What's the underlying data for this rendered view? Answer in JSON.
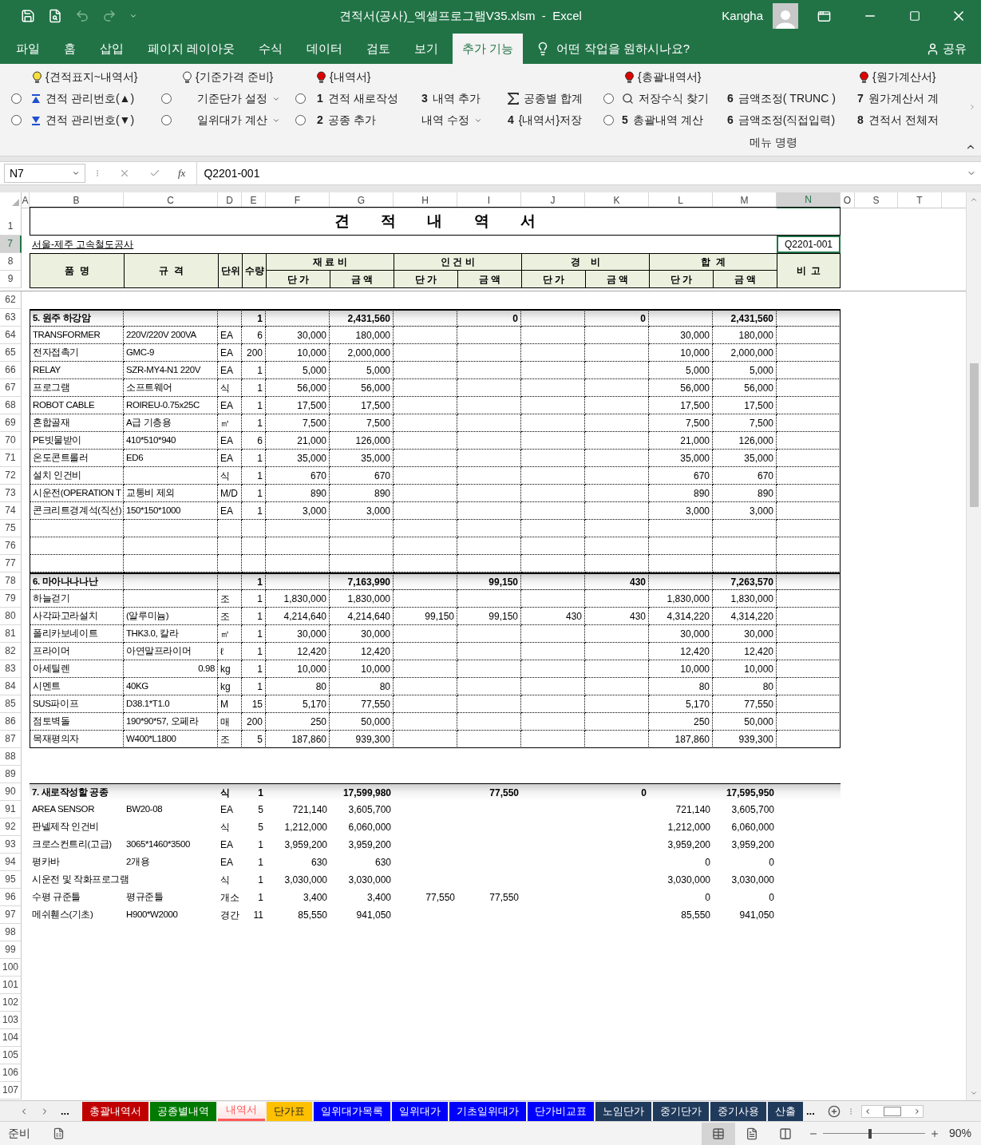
{
  "title_bar": {
    "quick_access": [
      {
        "kind": "save",
        "disabled": false
      },
      {
        "kind": "preview",
        "disabled": false
      },
      {
        "kind": "undo",
        "disabled": true
      },
      {
        "kind": "redo",
        "disabled": true
      }
    ],
    "title": "견적서(공사)_엑셀프로그램V35.xlsm  -  Excel",
    "user": "Kangha"
  },
  "menu_tabs": [
    {
      "label": "파일",
      "selected": false
    },
    {
      "label": "홈",
      "selected": false
    },
    {
      "label": "삽입",
      "selected": false
    },
    {
      "label": "페이지 레이아웃",
      "selected": false
    },
    {
      "label": "수식",
      "selected": false
    },
    {
      "label": "데이터",
      "selected": false
    },
    {
      "label": "검토",
      "selected": false
    },
    {
      "label": "보기",
      "selected": false
    },
    {
      "label": "추가 기능",
      "selected": true
    }
  ],
  "tell_me": "어떤 작업을 원하시나요?",
  "share": "공유",
  "ribbon": {
    "columns": [
      {
        "header": {
          "label": "{견적표지~내역서}",
          "color": "#f7e03c"
        },
        "items": [
          {
            "radio": {
              "selected": false
            },
            "kind": "ascending",
            "label": "견적 관리번호(▲)"
          },
          {
            "radio": {
              "selected": false
            },
            "kind": "descending",
            "label": "견적 관리번호(▼)"
          }
        ]
      },
      {
        "header": {
          "label": "{기준가격 준비}",
          "color": "#ffffff"
        },
        "items": [
          {
            "radio": {
              "selected": false
            },
            "kind": "dropdown",
            "label": "기준단가 설정"
          },
          {
            "radio": {
              "selected": false
            },
            "kind": "dropdown",
            "label": "일위대가 계산"
          }
        ]
      },
      {
        "header": {
          "label": "{내역서}",
          "color": "#e00000"
        },
        "items": [
          {
            "radio": {
              "selected": false
            },
            "kind": "text",
            "key": "1",
            "label": "견적 새로작성"
          },
          {
            "radio": {
              "selected": false
            },
            "kind": "text",
            "key": "2",
            "label": "공종 추가"
          }
        ]
      },
      {
        "items": [
          {
            "kind": "text",
            "key": "3",
            "label": "내역 추가"
          },
          {
            "kind": "dropdown",
            "label": "내역 수정"
          }
        ]
      },
      {
        "items": [
          {
            "kind": "sum",
            "label": "공종별 합계"
          },
          {
            "kind": "text",
            "key": "4",
            "label": "{내역서}저장"
          }
        ]
      },
      {
        "header": {
          "label": "{총괄내역서}",
          "color": "#e00000"
        },
        "items": [
          {
            "radio": {
              "selected": false
            },
            "kind": "search",
            "label": "저장수식 찾기"
          },
          {
            "radio": {
              "selected": false
            },
            "kind": "text",
            "key": "5",
            "label": "총괄내역 계산"
          }
        ]
      },
      {
        "items": [
          {
            "kind": "text",
            "key": "6",
            "label": "금액조정( TRUNC )"
          },
          {
            "kind": "text",
            "key": "6",
            "label": "금액조정(직접입력)"
          }
        ]
      },
      {
        "header": {
          "label": "{원가계산서}",
          "color": "#e00000"
        },
        "items": [
          {
            "kind": "text",
            "key": "7",
            "label": "원가계산서 계"
          },
          {
            "kind": "text",
            "key": "8",
            "label": "견적서 전체저"
          }
        ]
      }
    ],
    "group_label": "메뉴 명령"
  },
  "formula_bar": {
    "name_box": "N7",
    "function_label": "fx",
    "value": "Q2201-001"
  },
  "sheet": {
    "columns": [
      {
        "label": "A",
        "selected": false
      },
      {
        "label": "B",
        "selected": false
      },
      {
        "label": "C",
        "selected": false
      },
      {
        "label": "D",
        "selected": false
      },
      {
        "label": "E",
        "selected": false
      },
      {
        "label": "F",
        "selected": false
      },
      {
        "label": "G",
        "selected": false
      },
      {
        "label": "H",
        "selected": false
      },
      {
        "label": "I",
        "selected": false
      },
      {
        "label": "J",
        "selected": false
      },
      {
        "label": "K",
        "selected": false
      },
      {
        "label": "L",
        "selected": false
      },
      {
        "label": "M",
        "selected": false
      },
      {
        "label": "N",
        "selected": true
      },
      {
        "label": "O",
        "selected": false
      },
      {
        "label": "S",
        "selected": false
      },
      {
        "label": "T",
        "selected": false
      }
    ],
    "title_row": {
      "num": "1",
      "selected": false,
      "title": "견 적 내 역 서"
    },
    "info_row": {
      "num": "7",
      "selected": true,
      "project": "서울-제주 고속철도공사",
      "quote_no": "Q2201-001"
    },
    "header_rows": {
      "nums": [
        "8",
        "9"
      ],
      "fixed": [
        "품  명",
        "규  격",
        "단위",
        "수량"
      ],
      "groups": [
        {
          "label": "재 료 비",
          "columns": [
            "단 가",
            "금 액"
          ]
        },
        {
          "label": "인 건 비",
          "columns": [
            "단 가",
            "금 액"
          ]
        },
        {
          "label": "경    비",
          "columns": [
            "단 가",
            "금 액"
          ]
        },
        {
          "label": "합  계",
          "columns": [
            "단 가",
            "금 액"
          ]
        }
      ],
      "note": "비  고"
    },
    "rows": [
      {
        "num": "62",
        "selected": false,
        "kind": "item",
        "boxed": false
      },
      {
        "num": "63",
        "selected": false,
        "kind": "group",
        "boxed": true,
        "cells": {
          "B": "5. 원주 하강암",
          "E": "1",
          "G": "2,431,560",
          "I": "0",
          "K": "0",
          "M": "2,431,560"
        }
      },
      {
        "num": "64",
        "selected": false,
        "kind": "item",
        "boxed": true,
        "cells": {
          "B": "TRANSFORMER",
          "C": "220V/220V 200VA",
          "D": "EA",
          "E": "6",
          "F": "30,000",
          "G": "180,000",
          "L": "30,000",
          "M": "180,000"
        }
      },
      {
        "num": "65",
        "selected": false,
        "kind": "item",
        "boxed": true,
        "cells": {
          "B": "전자접촉기",
          "C": "GMC-9",
          "D": "EA",
          "E": "200",
          "F": "10,000",
          "G": "2,000,000",
          "L": "10,000",
          "M": "2,000,000"
        }
      },
      {
        "num": "66",
        "selected": false,
        "kind": "item",
        "boxed": true,
        "cells": {
          "B": "RELAY",
          "C": "SZR-MY4-N1 220V",
          "D": "EA",
          "E": "1",
          "F": "5,000",
          "G": "5,000",
          "L": "5,000",
          "M": "5,000"
        }
      },
      {
        "num": "67",
        "selected": false,
        "kind": "item",
        "boxed": true,
        "cells": {
          "B": "프로그램",
          "C": "소프트웨어",
          "D": "식",
          "E": "1",
          "F": "56,000",
          "G": "56,000",
          "L": "56,000",
          "M": "56,000"
        }
      },
      {
        "num": "68",
        "selected": false,
        "kind": "item",
        "boxed": true,
        "cells": {
          "B": "ROBOT CABLE",
          "C": "ROIREU-0.75x25C",
          "D": "EA",
          "E": "1",
          "F": "17,500",
          "G": "17,500",
          "L": "17,500",
          "M": "17,500"
        }
      },
      {
        "num": "69",
        "selected": false,
        "kind": "item",
        "boxed": true,
        "cells": {
          "B": "혼합골재",
          "C": "A급 기층용",
          "D": "㎥",
          "E": "1",
          "F": "7,500",
          "G": "7,500",
          "L": "7,500",
          "M": "7,500"
        }
      },
      {
        "num": "70",
        "selected": false,
        "kind": "item",
        "boxed": true,
        "cells": {
          "B": "PE빗물받이",
          "C": "410*510*940",
          "D": "EA",
          "E": "6",
          "F": "21,000",
          "G": "126,000",
          "L": "21,000",
          "M": "126,000"
        }
      },
      {
        "num": "71",
        "selected": false,
        "kind": "item",
        "boxed": true,
        "cells": {
          "B": "온도콘트롤러",
          "C": "ED6",
          "D": "EA",
          "E": "1",
          "F": "35,000",
          "G": "35,000",
          "L": "35,000",
          "M": "35,000"
        }
      },
      {
        "num": "72",
        "selected": false,
        "kind": "item",
        "boxed": true,
        "cells": {
          "B": "설치 인건비",
          "D": "식",
          "E": "1",
          "F": "670",
          "G": "670",
          "L": "670",
          "M": "670"
        }
      },
      {
        "num": "73",
        "selected": false,
        "kind": "item",
        "boxed": true,
        "cells": {
          "B": "시운전(OPERATION T",
          "C": "교통비 제외",
          "D": "M/D",
          "E": "1",
          "F": "890",
          "G": "890",
          "L": "890",
          "M": "890"
        }
      },
      {
        "num": "74",
        "selected": false,
        "kind": "item",
        "boxed": true,
        "cells": {
          "B": "콘크리트경계석(직선)",
          "C": "150*150*1000",
          "D": "EA",
          "E": "1",
          "F": "3,000",
          "G": "3,000",
          "L": "3,000",
          "M": "3,000"
        }
      },
      {
        "num": "75",
        "selected": false,
        "kind": "item",
        "boxed": true
      },
      {
        "num": "76",
        "selected": false,
        "kind": "item",
        "boxed": true
      },
      {
        "num": "77",
        "selected": false,
        "kind": "item",
        "boxed": true
      },
      {
        "num": "78",
        "selected": false,
        "kind": "group",
        "boxed": true,
        "cells": {
          "B": "6. 마아나나나난",
          "E": "1",
          "G": "7,163,990",
          "I": "99,150",
          "K": "430",
          "M": "7,263,570"
        }
      },
      {
        "num": "79",
        "selected": false,
        "kind": "item",
        "boxed": true,
        "cells": {
          "B": "하늘걷기",
          "D": "조",
          "E": "1",
          "F": "1,830,000",
          "G": "1,830,000",
          "L": "1,830,000",
          "M": "1,830,000"
        }
      },
      {
        "num": "80",
        "selected": false,
        "kind": "item",
        "boxed": true,
        "cells": {
          "B": "사각파고라설치",
          "C": "(알루미늄)",
          "D": "조",
          "E": "1",
          "F": "4,214,640",
          "G": "4,214,640",
          "H": "99,150",
          "I": "99,150",
          "J": "430",
          "K": "430",
          "L": "4,314,220",
          "M": "4,314,220"
        }
      },
      {
        "num": "81",
        "selected": false,
        "kind": "item",
        "boxed": true,
        "cells": {
          "B": "폴리카보네이트",
          "C": "THK3.0, 칼라",
          "D": "㎡",
          "E": "1",
          "F": "30,000",
          "G": "30,000",
          "L": "30,000",
          "M": "30,000"
        }
      },
      {
        "num": "82",
        "selected": false,
        "kind": "item",
        "boxed": true,
        "cells": {
          "B": "프라이머",
          "C": "아연말프라이머",
          "D": "ℓ",
          "E": "1",
          "F": "12,420",
          "G": "12,420",
          "L": "12,420",
          "M": "12,420"
        }
      },
      {
        "num": "83",
        "selected": false,
        "kind": "item",
        "boxed": true,
        "cells": {
          "B": "아세틸렌",
          "C": {
            "text": "0.98",
            "right_aligned": true
          },
          "D": "kg",
          "E": "1",
          "F": "10,000",
          "G": "10,000",
          "L": "10,000",
          "M": "10,000"
        }
      },
      {
        "num": "84",
        "selected": false,
        "kind": "item",
        "boxed": true,
        "cells": {
          "B": "시멘트",
          "C": "40KG",
          "D": "kg",
          "E": "1",
          "F": "80",
          "G": "80",
          "L": "80",
          "M": "80"
        }
      },
      {
        "num": "85",
        "selected": false,
        "kind": "item",
        "boxed": true,
        "cells": {
          "B": "SUS파이프",
          "C": "D38.1*T1.0",
          "D": "M",
          "E": "15",
          "F": "5,170",
          "G": "77,550",
          "L": "5,170",
          "M": "77,550"
        }
      },
      {
        "num": "86",
        "selected": false,
        "kind": "item",
        "boxed": true,
        "cells": {
          "B": "점토벽돌",
          "C": "190*90*57, 오페라",
          "D": "매",
          "E": "200",
          "F": "250",
          "G": "50,000",
          "L": "250",
          "M": "50,000"
        }
      },
      {
        "num": "87",
        "selected": false,
        "kind": "item",
        "boxed": true,
        "cells": {
          "B": "목재평의자",
          "C": "W400*L1800",
          "D": "조",
          "E": "5",
          "F": "187,860",
          "G": "939,300",
          "L": "187,860",
          "M": "939,300"
        }
      },
      {
        "num": "88",
        "selected": false,
        "kind": "item",
        "boxed": false
      },
      {
        "num": "89",
        "selected": false,
        "kind": "item",
        "boxed": false
      },
      {
        "num": "90",
        "selected": false,
        "kind": "group",
        "boxed": false,
        "cells": {
          "B": "7. 새로작성할 공종",
          "D": "식",
          "E": "1",
          "G": "17,599,980",
          "I": "77,550",
          "K": "0",
          "M": "17,595,950"
        }
      },
      {
        "num": "91",
        "selected": false,
        "kind": "item",
        "boxed": false,
        "cells": {
          "B": "AREA SENSOR",
          "C": "BW20-08",
          "D": "EA",
          "E": "5",
          "F": "721,140",
          "G": "3,605,700",
          "L": "721,140",
          "M": "3,605,700"
        }
      },
      {
        "num": "92",
        "selected": false,
        "kind": "item",
        "boxed": false,
        "cells": {
          "B": "판넬제작 인건비",
          "D": "식",
          "E": "5",
          "F": "1,212,000",
          "G": "6,060,000",
          "L": "1,212,000",
          "M": "6,060,000"
        }
      },
      {
        "num": "93",
        "selected": false,
        "kind": "item",
        "boxed": false,
        "cells": {
          "B": "크로스컨트리(고급)",
          "C": "3065*1460*3500",
          "D": "EA",
          "E": "1",
          "F": "3,959,200",
          "G": "3,959,200",
          "L": "3,959,200",
          "M": "3,959,200"
        }
      },
      {
        "num": "94",
        "selected": false,
        "kind": "item",
        "boxed": false,
        "cells": {
          "B": "평카바",
          "C": "2개용",
          "D": "EA",
          "E": "1",
          "F": "630",
          "G": "630",
          "L": "0",
          "M": "0"
        }
      },
      {
        "num": "95",
        "selected": false,
        "kind": "item",
        "boxed": false,
        "cells": {
          "B": "시운전 및 작화프로그램",
          "D": "식",
          "E": "1",
          "F": "3,030,000",
          "G": "3,030,000",
          "L": "3,030,000",
          "M": "3,030,000"
        }
      },
      {
        "num": "96",
        "selected": false,
        "kind": "item",
        "boxed": false,
        "cells": {
          "B": "수평 규준틀",
          "C": "평규준틀",
          "D": "개소",
          "E": "1",
          "F": "3,400",
          "G": "3,400",
          "H": "77,550",
          "I": "77,550",
          "L": "0",
          "M": "0"
        }
      },
      {
        "num": "97",
        "selected": false,
        "kind": "item",
        "boxed": false,
        "cells": {
          "B": "메쉬휀스(기초)",
          "C": "H900*W2000",
          "D": "경간",
          "E": "11",
          "F": "85,550",
          "G": "941,050",
          "L": "85,550",
          "M": "941,050"
        }
      },
      {
        "num": "98",
        "selected": false,
        "kind": "item",
        "boxed": false
      },
      {
        "num": "99",
        "selected": false,
        "kind": "item",
        "boxed": false
      },
      {
        "num": "100",
        "selected": false,
        "kind": "item",
        "boxed": false
      },
      {
        "num": "101",
        "selected": false,
        "kind": "item",
        "boxed": false
      },
      {
        "num": "102",
        "selected": false,
        "kind": "item",
        "boxed": false
      },
      {
        "num": "103",
        "selected": false,
        "kind": "item",
        "boxed": false
      },
      {
        "num": "104",
        "selected": false,
        "kind": "item",
        "boxed": false
      },
      {
        "num": "105",
        "selected": false,
        "kind": "item",
        "boxed": false
      },
      {
        "num": "106",
        "selected": false,
        "kind": "item",
        "boxed": false
      },
      {
        "num": "107",
        "selected": false,
        "kind": "item",
        "boxed": false
      }
    ]
  },
  "sheet_nav": {
    "more": "...",
    "more_right": "..."
  },
  "sheet_tabs": [
    {
      "label": "총괄내역서",
      "color": "#c00000",
      "selected": false
    },
    {
      "label": "공종별내역",
      "color": "#007a00",
      "selected": false
    },
    {
      "label": "내역서",
      "color": "#ff5a5a",
      "selected": true
    },
    {
      "label": "단가표",
      "color": "#ffc000",
      "selected": false
    },
    {
      "label": "일위대가목록",
      "color": "#0000ff",
      "selected": false
    },
    {
      "label": "일위대가",
      "color": "#0000ff",
      "selected": false
    },
    {
      "label": "기초일위대가",
      "color": "#0000ff",
      "selected": false
    },
    {
      "label": "단가비교표",
      "color": "#0000ff",
      "selected": false
    },
    {
      "label": "노임단가",
      "color": "#203a5c",
      "selected": false
    },
    {
      "label": "중기단가",
      "color": "#203a5c",
      "selected": false
    },
    {
      "label": "중기사용",
      "color": "#203a5c",
      "selected": false
    },
    {
      "label": "산출",
      "color": "#203a5c",
      "selected": false
    }
  ],
  "status_bar": {
    "status": "준비",
    "views": [
      {
        "kind": "normal",
        "selected": true
      },
      {
        "kind": "page_layout",
        "selected": false
      },
      {
        "kind": "page_break",
        "selected": false
      }
    ],
    "zoom": {
      "level": 0.46,
      "reading": "90%"
    }
  }
}
